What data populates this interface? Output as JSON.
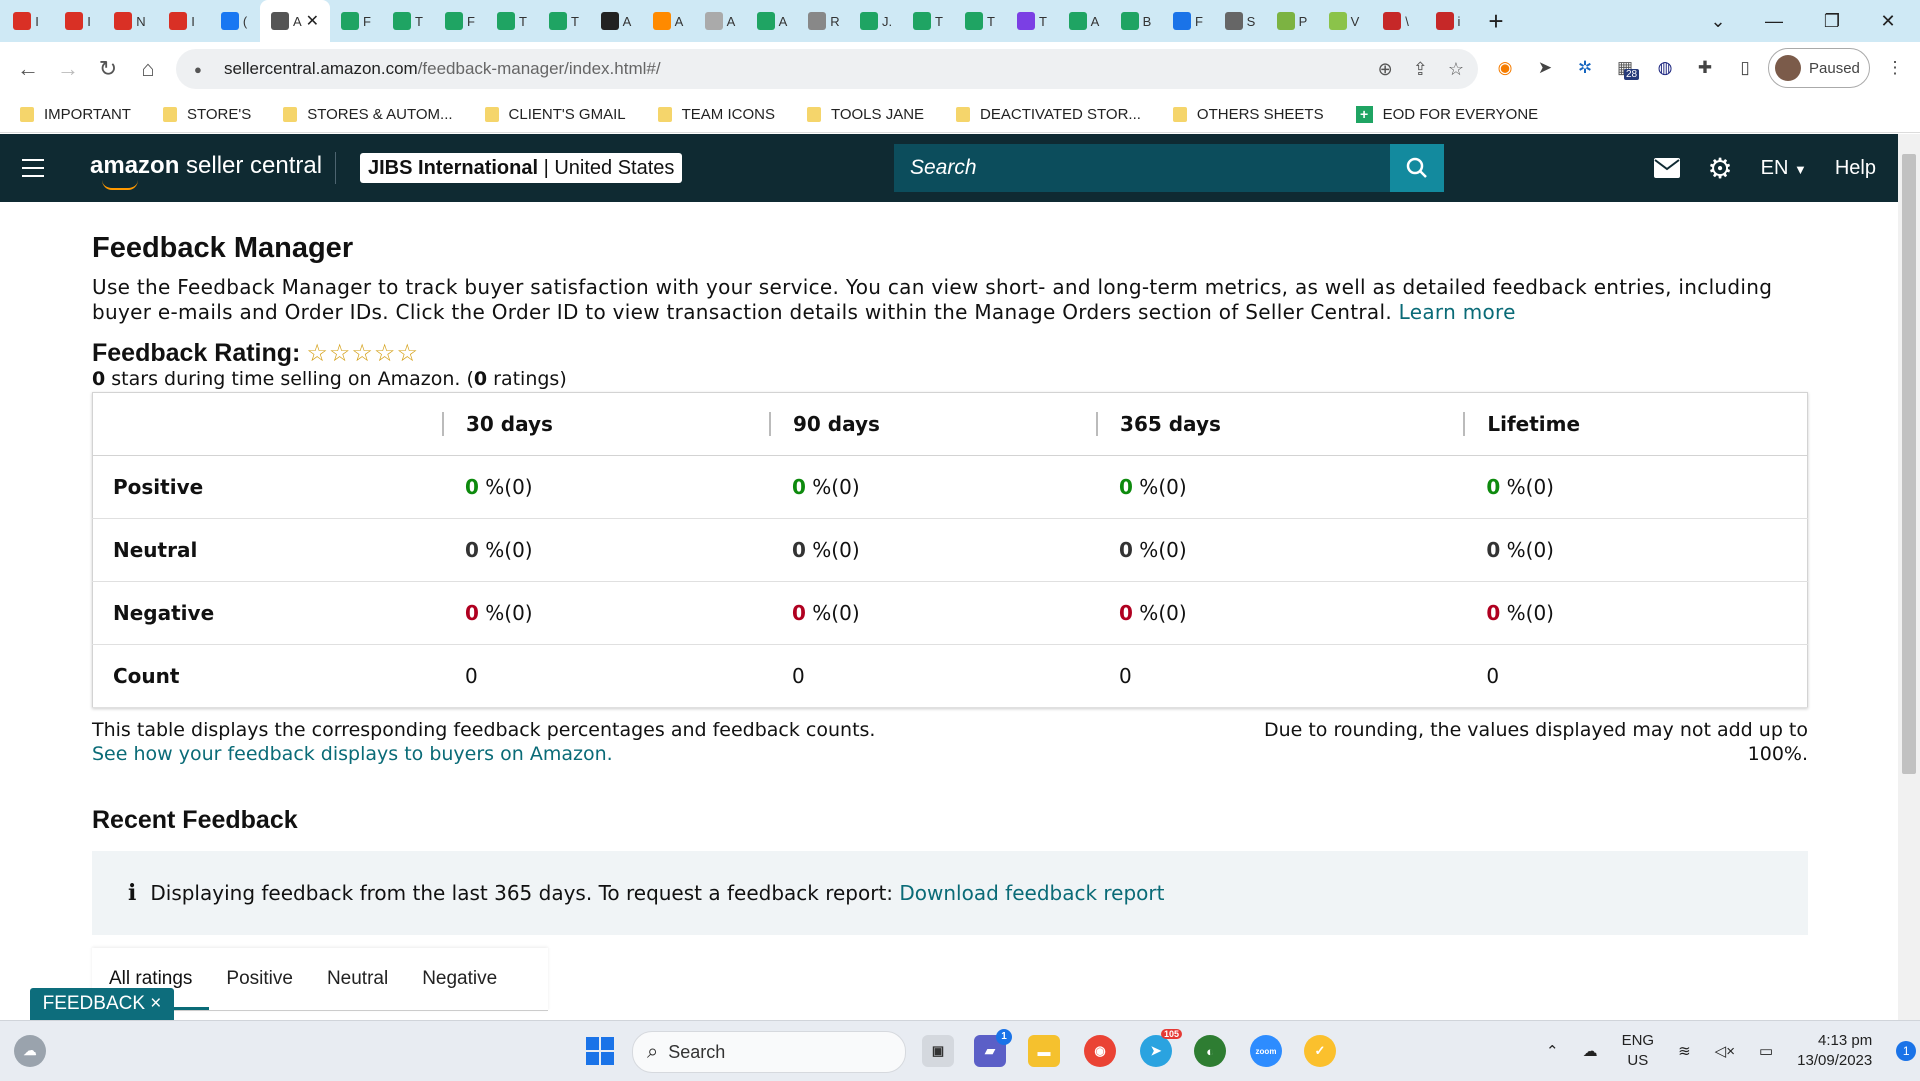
{
  "browser": {
    "tabs": [
      {
        "icon": "gmail-icon",
        "label": "I",
        "color": "#d93025"
      },
      {
        "icon": "gmail-icon",
        "label": "I",
        "color": "#d93025"
      },
      {
        "icon": "gmail-icon",
        "label": "N",
        "color": "#d93025"
      },
      {
        "icon": "gmail-icon",
        "label": "I",
        "color": "#d93025"
      },
      {
        "icon": "facebook-icon",
        "label": "(",
        "color": "#1877f2"
      },
      {
        "icon": "amazon-icon",
        "label": "A",
        "color": "#555555",
        "active": true
      },
      {
        "icon": "sheets-icon",
        "label": "F",
        "color": "#1fa463"
      },
      {
        "icon": "sheets-icon",
        "label": "T",
        "color": "#1fa463"
      },
      {
        "icon": "sheets-icon",
        "label": "F",
        "color": "#1fa463"
      },
      {
        "icon": "sheets-icon",
        "label": "T",
        "color": "#1fa463"
      },
      {
        "icon": "sheets-icon",
        "label": "T",
        "color": "#1fa463"
      },
      {
        "icon": "chatgpt-icon",
        "label": "A",
        "color": "#222222"
      },
      {
        "icon": "pencil-icon",
        "label": "A",
        "color": "#ff8a00"
      },
      {
        "icon": "globe-icon",
        "label": "A",
        "color": "#aaaaaa"
      },
      {
        "icon": "sheets-icon",
        "label": "A",
        "color": "#1fa463"
      },
      {
        "icon": "document-icon",
        "label": "R",
        "color": "#888888"
      },
      {
        "icon": "sheets-icon",
        "label": "J.",
        "color": "#1fa463"
      },
      {
        "icon": "sheets-icon",
        "label": "T",
        "color": "#1fa463"
      },
      {
        "icon": "sheets-icon",
        "label": "T",
        "color": "#1fa463"
      },
      {
        "icon": "messenger-icon",
        "label": "T",
        "color": "#7b3fe4"
      },
      {
        "icon": "sheets-icon",
        "label": "A",
        "color": "#1fa463"
      },
      {
        "icon": "sheets-icon",
        "label": "B",
        "color": "#1fa463"
      },
      {
        "icon": "fiverr-icon",
        "label": "F",
        "color": "#1a73e8"
      },
      {
        "icon": "document-icon",
        "label": "S",
        "color": "#666666"
      },
      {
        "icon": "wix-icon",
        "label": "P",
        "color": "#7cb342"
      },
      {
        "icon": "leaf-icon",
        "label": "V",
        "color": "#8bc34a"
      },
      {
        "icon": "walmart-icon",
        "label": "\\",
        "color": "#c62828"
      },
      {
        "icon": "shield-icon",
        "label": "i",
        "color": "#c62828"
      }
    ],
    "url_host": "sellercentral.amazon.com",
    "url_path": "/feedback-manager/index.html#/",
    "profile_label": "Paused",
    "calendar_badge": "28",
    "bookmarks": [
      {
        "icon": "folder-icon",
        "label": "IMPORTANT"
      },
      {
        "icon": "folder-icon",
        "label": "STORE'S"
      },
      {
        "icon": "folder-icon",
        "label": "STORES & AUTOM..."
      },
      {
        "icon": "folder-icon",
        "label": "CLIENT'S GMAIL"
      },
      {
        "icon": "folder-icon",
        "label": "TEAM ICONS"
      },
      {
        "icon": "folder-icon",
        "label": "TOOLS JANE"
      },
      {
        "icon": "folder-icon",
        "label": "DEACTIVATED STOR..."
      },
      {
        "icon": "folder-icon",
        "label": "OTHERS SHEETS"
      },
      {
        "icon": "sheets-icon",
        "label": "EOD FOR EVERYONE"
      }
    ]
  },
  "header": {
    "logo_bold": "amazon",
    "logo_rest": " seller central",
    "account_name": "JIBS International",
    "account_sep": " | ",
    "account_region": "United States",
    "search_placeholder": "Search",
    "language": "EN",
    "help": "Help"
  },
  "page": {
    "title": "Feedback Manager",
    "description": "Use the Feedback Manager to track buyer satisfaction with your service. You can view short- and long-term metrics, as well as detailed feedback entries, including buyer e-mails and Order IDs. Click the Order ID to view transaction details within the Manage Orders section of Seller Central.",
    "learn_more": "Learn more",
    "rating_title": "Feedback Rating:",
    "stars_display": "☆☆☆☆☆",
    "stars_value": 0,
    "subline_stars": "0",
    "subline_a": " stars during time selling on Amazon. (",
    "subline_ratings": "0",
    "subline_b": " ratings)",
    "table": {
      "headers": [
        "30 days",
        "90 days",
        "365 days",
        "Lifetime"
      ],
      "rows": [
        {
          "label": "Positive",
          "cells": [
            "0",
            "0",
            "0",
            "0"
          ],
          "suffix": " %(0)"
        },
        {
          "label": "Neutral",
          "cells": [
            "0",
            "0",
            "0",
            "0"
          ],
          "suffix": " %(0)"
        },
        {
          "label": "Negative",
          "cells": [
            "0",
            "0",
            "0",
            "0"
          ],
          "suffix": " %(0)"
        },
        {
          "label": "Count",
          "cells": [
            "0",
            "0",
            "0",
            "0"
          ]
        }
      ]
    },
    "note_left": "This table displays the corresponding feedback percentages and feedback counts.",
    "note_link": "See how your feedback displays to buyers on Amazon.",
    "note_right": "Due to rounding, the values displayed may not add up to 100%.",
    "recent_title": "Recent Feedback",
    "info_text": "Displaying feedback from the last 365 days. To request a feedback report: ",
    "info_link": "Download feedback report",
    "tabs": [
      "All ratings",
      "Positive",
      "Neutral",
      "Negative"
    ],
    "feedback_pill": "FEEDBACK ×"
  },
  "taskbar": {
    "search": "Search",
    "lang_top": "ENG",
    "lang_bottom": "US",
    "time": "4:13 pm",
    "date": "13/09/2023",
    "notification_count": "1",
    "teams_badge": "1",
    "telegram_badge": "105"
  },
  "colors": {
    "amazon_header": "#0f2a32",
    "positive": "#0d8a0d",
    "negative": "#b00020",
    "link": "#0a6b77",
    "accent": "#138a9e"
  }
}
